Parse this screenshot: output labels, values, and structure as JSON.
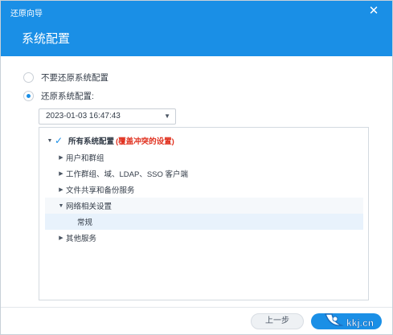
{
  "window": {
    "title": "还原向导",
    "close_glyph": "✕"
  },
  "page": {
    "heading": "系统配置"
  },
  "options": {
    "no_restore": "不要还原系统配置",
    "restore": "还原系统配置:"
  },
  "date_select": {
    "value": "2023-01-03 16:47:43",
    "caret": "▼"
  },
  "tree": {
    "root": {
      "arrow": "▼",
      "label": "所有系统配置",
      "warning": "(覆盖冲突的设置)"
    },
    "items": [
      {
        "arrow": "▶",
        "label": "用户和群组"
      },
      {
        "arrow": "▶",
        "label": "工作群组、域、LDAP、SSO 客户端"
      },
      {
        "arrow": "▶",
        "label": "文件共享和备份服务"
      },
      {
        "arrow": "▼",
        "label": "网络相关设置"
      },
      {
        "arrow": "",
        "label": "常规"
      },
      {
        "arrow": "▶",
        "label": "其他服务"
      }
    ]
  },
  "footer": {
    "prev_label": "上一步"
  },
  "watermark": {
    "text": "kkj.cn"
  },
  "colors": {
    "accent": "#1a8fe6",
    "warning": "#e0301e"
  },
  "icons": {
    "close": "close-icon",
    "check": "check-icon",
    "caret": "chevron-down-icon"
  }
}
